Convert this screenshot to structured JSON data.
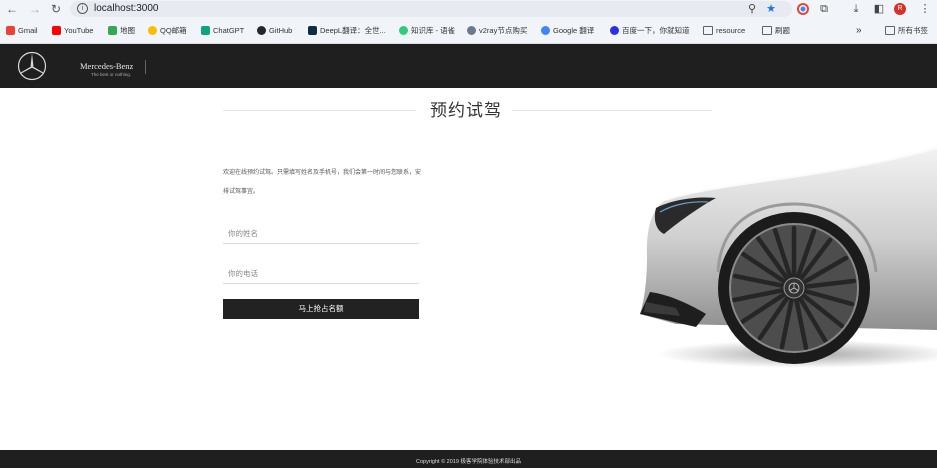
{
  "browser": {
    "url": "localhost:3000",
    "bookmarks": [
      {
        "label": "Gmail",
        "color": "#ea4335"
      },
      {
        "label": "YouTube",
        "color": "#ff0000"
      },
      {
        "label": "地图",
        "color": "#34a853"
      },
      {
        "label": "QQ邮箱",
        "color": "#fbbc04"
      },
      {
        "label": "ChatGPT",
        "color": "#10a37f"
      },
      {
        "label": "GitHub",
        "color": "#24292e"
      },
      {
        "label": "DeepL翻译：全世...",
        "color": "#0f2b46"
      },
      {
        "label": "知识库 - 语雀",
        "color": "#31cc79"
      },
      {
        "label": "v2ray节点购买",
        "color": "#6b7a8f"
      },
      {
        "label": "Google 翻译",
        "color": "#4285f4"
      },
      {
        "label": "百度一下，你就知道",
        "color": "#2932e1"
      },
      {
        "label": "resource",
        "color": "#5f6368"
      },
      {
        "label": "刷题",
        "color": "#5f6368"
      }
    ],
    "overflow": "»",
    "all_bookmarks": "所有书签",
    "profile_initial": "R"
  },
  "header": {
    "brand": "Mercedes-Benz",
    "tagline": "The best or nothing."
  },
  "page": {
    "title": "预约试驾",
    "intro": "欢迎在线预约试驾。只需填写姓名及手机号，我们会第一时间与您联系，安排试驾事宜。",
    "name_placeholder": "你的姓名",
    "phone_placeholder": "你的电话",
    "submit_label": "马上抢占名额"
  },
  "footer": {
    "copyright": "Copyright © 2019 极客学院体验技术部出品"
  },
  "colors": {
    "header_bg": "#1f1f1f",
    "button_bg": "#222222",
    "accent_profile": "#d93025"
  }
}
